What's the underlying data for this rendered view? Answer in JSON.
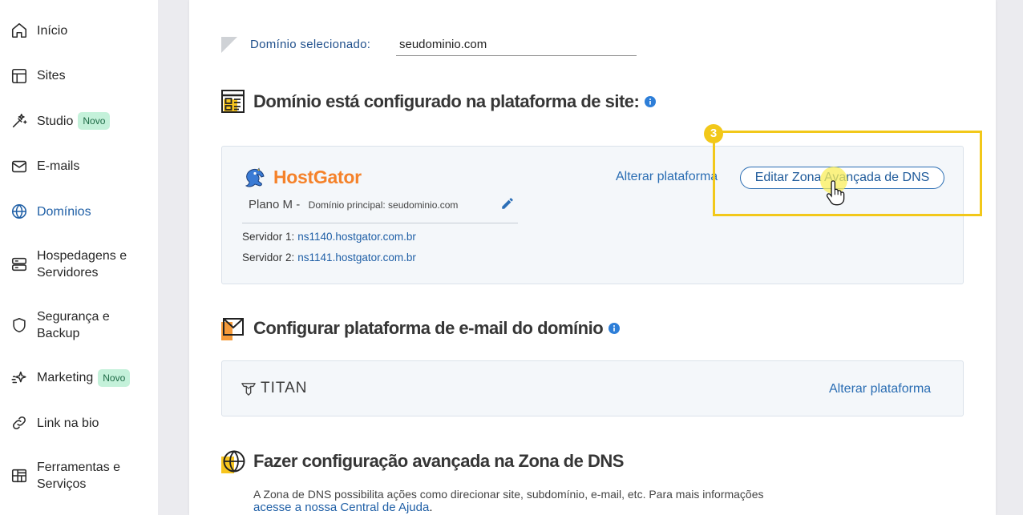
{
  "colors": {
    "accent": "#1f5fa6",
    "link": "#2a6db3",
    "annotation": "#f2c81a",
    "badge_bg": "#c4f1da",
    "badge_text": "#1d6a45",
    "hostgator_orange": "#f5822a"
  },
  "sidebar": {
    "items": [
      {
        "label": "Início",
        "icon": "home-icon",
        "active": false
      },
      {
        "label": "Sites",
        "icon": "layout-icon",
        "active": false
      },
      {
        "label": "Studio",
        "icon": "magic-wand-icon",
        "badge": "Novo",
        "active": false
      },
      {
        "label": "E-mails",
        "icon": "envelope-icon",
        "active": false
      },
      {
        "label": "Domínios",
        "icon": "globe-icon",
        "active": true
      },
      {
        "label": "Hospedagens e Servidores",
        "icon": "server-icon",
        "active": false
      },
      {
        "label": "Segurança e Backup",
        "icon": "shield-icon",
        "active": false
      },
      {
        "label": "Marketing",
        "icon": "sparkle-icon",
        "badge": "Novo",
        "active": false
      },
      {
        "label": "Link na bio",
        "icon": "link-icon",
        "active": false
      },
      {
        "label": "Ferramentas e Serviços",
        "icon": "toolbox-icon",
        "active": false
      }
    ]
  },
  "domain_selector": {
    "label": "Domínio selecionado:",
    "value": "seudominio.com"
  },
  "site_platform": {
    "title": "Domínio está configurado na plataforma de site:",
    "provider": "HostGator",
    "plan": "Plano M -",
    "main_domain": "Domínio principal: seudominio.com",
    "servers": [
      {
        "label": "Servidor 1:",
        "value": "ns1140.hostgator.com.br"
      },
      {
        "label": "Servidor 2:",
        "value": "ns1141.hostgator.com.br"
      }
    ],
    "change_link": "Alterar plataforma",
    "edit_dns_button": "Editar Zona Avançada de DNS"
  },
  "annotation": {
    "step": "3"
  },
  "email_platform": {
    "title": "Configurar plataforma de e-mail do domínio",
    "provider": "TITAN",
    "change_link": "Alterar plataforma"
  },
  "dns_zone": {
    "title": "Fazer configuração avançada na Zona de DNS",
    "description": "A Zona de DNS possibilita ações como direcionar site, subdomínio, e-mail, etc. Para mais informações",
    "help_link": "acesse a nossa Central de Ajuda",
    "help_suffix": "."
  }
}
